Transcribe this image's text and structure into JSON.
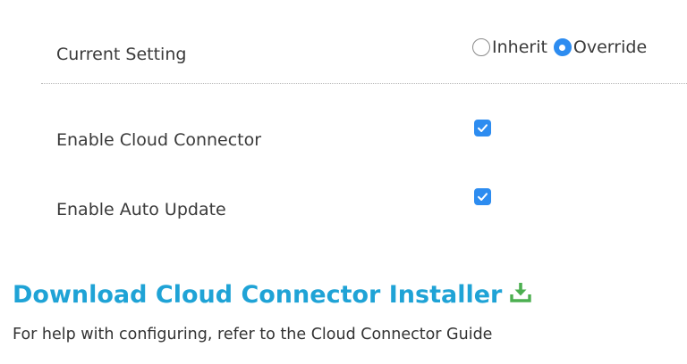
{
  "current_setting": {
    "label": "Current Setting",
    "options": [
      {
        "label": "Inherit",
        "selected": false
      },
      {
        "label": "Override",
        "selected": true
      }
    ]
  },
  "settings": [
    {
      "label": "Enable Cloud Connector",
      "checked": true
    },
    {
      "label": "Enable Auto Update",
      "checked": true
    }
  ],
  "download": {
    "link_text": "Download Cloud Connector Installer",
    "icon": "download-icon"
  },
  "help_text": "For help with configuring, refer to the Cloud Connector Guide",
  "colors": {
    "accent": "#2d8cf0",
    "link": "#1fa3d6",
    "download_icon": "#4caf50"
  }
}
